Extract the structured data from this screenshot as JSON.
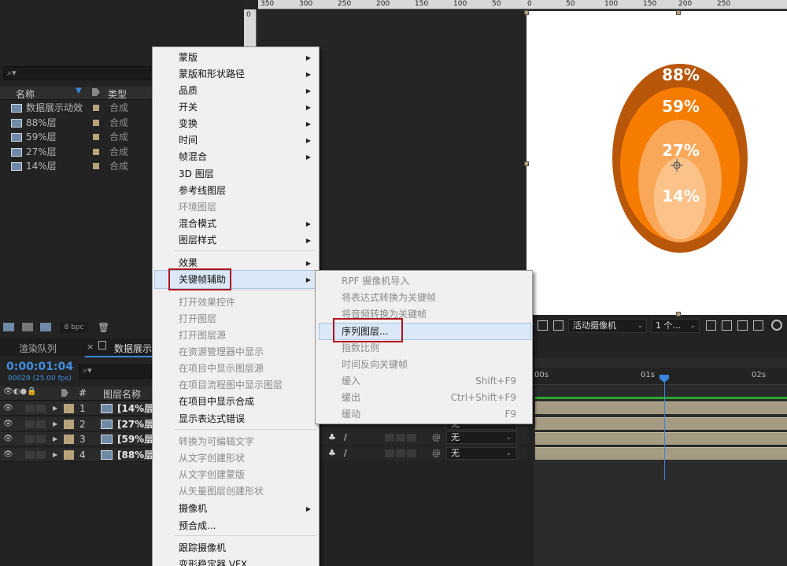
{
  "project_panel": {
    "search_placeholder": "⌕▾",
    "col_name": "名称",
    "col_type": "类型",
    "items": [
      {
        "name": "数据展示动效",
        "type": "合成"
      },
      {
        "name": "88%层",
        "type": "合成"
      },
      {
        "name": "59%层",
        "type": "合成"
      },
      {
        "name": "27%层",
        "type": "合成"
      },
      {
        "name": "14%层",
        "type": "合成"
      }
    ],
    "bpc": "8 bpc"
  },
  "rulers": {
    "top_ticks": [
      "350",
      "300",
      "250",
      "200",
      "150",
      "100",
      "50",
      "0",
      "50",
      "100",
      "150",
      "200",
      "250"
    ],
    "left_tick": "0"
  },
  "comp": {
    "labels": [
      "88%",
      "59%",
      "27%",
      "14%"
    ],
    "colors": {
      "outer": "#b8560a",
      "second": "#f57c00",
      "third": "#f9a85a",
      "inner": "#fbc38a"
    }
  },
  "context_menu": {
    "items": [
      {
        "label": "蒙版",
        "sub": true,
        "disabled": false
      },
      {
        "label": "蒙版和形状路径",
        "sub": true,
        "disabled": false
      },
      {
        "label": "品质",
        "sub": true,
        "disabled": false
      },
      {
        "label": "开关",
        "sub": true,
        "disabled": false
      },
      {
        "label": "变换",
        "sub": true,
        "disabled": false
      },
      {
        "label": "时间",
        "sub": true,
        "disabled": false
      },
      {
        "label": "帧混合",
        "sub": true,
        "disabled": false
      },
      {
        "label": "3D 图层",
        "sub": false,
        "disabled": false
      },
      {
        "label": "参考线图层",
        "sub": false,
        "disabled": false
      },
      {
        "label": "环境图层",
        "sub": false,
        "disabled": true
      },
      {
        "label": "混合模式",
        "sub": true,
        "disabled": false
      },
      {
        "label": "图层样式",
        "sub": true,
        "disabled": false
      },
      {
        "label": "效果",
        "sub": true,
        "disabled": false
      },
      {
        "label": "关键帧辅助",
        "sub": true,
        "disabled": false
      },
      {
        "label": "打开效果控件",
        "sub": false,
        "disabled": true
      },
      {
        "label": "打开图层",
        "sub": false,
        "disabled": true
      },
      {
        "label": "打开图层源",
        "sub": false,
        "disabled": true
      },
      {
        "label": "在资源管理器中显示",
        "sub": false,
        "disabled": true
      },
      {
        "label": "在项目中显示图层源",
        "sub": false,
        "disabled": true
      },
      {
        "label": "在项目流程图中显示图层",
        "sub": false,
        "disabled": true
      },
      {
        "label": "在项目中显示合成",
        "sub": false,
        "disabled": false
      },
      {
        "label": "显示表达式错误",
        "sub": false,
        "disabled": false
      },
      {
        "label": "转换为可编辑文字",
        "sub": false,
        "disabled": true
      },
      {
        "label": "从文字创建形状",
        "sub": false,
        "disabled": true
      },
      {
        "label": "从文字创建蒙版",
        "sub": false,
        "disabled": true
      },
      {
        "label": "从矢量图层创建形状",
        "sub": false,
        "disabled": true
      },
      {
        "label": "摄像机",
        "sub": true,
        "disabled": false
      },
      {
        "label": "预合成...",
        "sub": false,
        "disabled": false
      },
      {
        "label": "跟踪摄像机",
        "sub": false,
        "disabled": false
      },
      {
        "label": "变形稳定器 VFX",
        "sub": false,
        "disabled": false
      }
    ]
  },
  "submenu": {
    "items": [
      {
        "label": "RPF 摄像机导入",
        "shortcut": "",
        "active": false
      },
      {
        "label": "将表达式转换为关键帧",
        "shortcut": "",
        "active": false
      },
      {
        "label": "将音频转换为关键帧",
        "shortcut": "",
        "active": false
      },
      {
        "label": "序列图层...",
        "shortcut": "",
        "active": true
      },
      {
        "label": "指数比例",
        "shortcut": "",
        "active": false
      },
      {
        "label": "时间反向关键帧",
        "shortcut": "",
        "active": false
      },
      {
        "label": "缓入",
        "shortcut": "Shift+F9",
        "active": false
      },
      {
        "label": "缓出",
        "shortcut": "Ctrl+Shift+F9",
        "active": false
      },
      {
        "label": "缓动",
        "shortcut": "F9",
        "active": false
      }
    ]
  },
  "timeline": {
    "tab_render": "渲染队列",
    "tab_comp": "数据展示",
    "timecode": "0:00:01:04",
    "fps": "00029 (25.00 fps)",
    "search_placeholder": "⌕▾",
    "col_num": "#",
    "col_layer": "图层名称",
    "layers": [
      {
        "num": "1",
        "name": "[14%层"
      },
      {
        "num": "2",
        "name": "[27%层"
      },
      {
        "num": "3",
        "name": "[59%层"
      },
      {
        "num": "4",
        "name": "[88%层"
      }
    ],
    "parent_values": [
      "无",
      "无",
      "无"
    ],
    "ruler_labels": [
      "00s",
      "01s",
      "02s"
    ]
  },
  "viewer_toolbar": {
    "camera": "活动摄像机",
    "views": "1 个..."
  }
}
